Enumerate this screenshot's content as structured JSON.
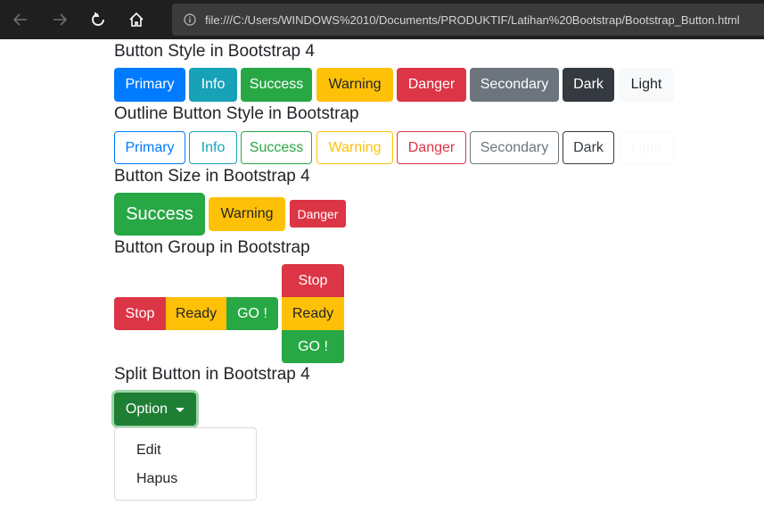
{
  "browser": {
    "url": "file:///C:/Users/WINDOWS%2010/Documents/PRODUKTIF/Latihan%20Bootstrap/Bootstrap_Button.html",
    "icons": [
      "back-arrow-icon",
      "forward-arrow-icon",
      "reload-icon",
      "home-icon",
      "info-icon"
    ]
  },
  "sections": {
    "styles_title": "Button Style in Bootstrap 4",
    "outline_title": "Outline Button Style in Bootstrap",
    "size_title": "Button Size in Bootstrap 4",
    "group_title": "Button Group in Bootstrap",
    "split_title": "Split Button in Bootstrap 4"
  },
  "style_buttons": [
    "Primary",
    "Info",
    "Success",
    "Warning",
    "Danger",
    "Secondary",
    "Dark",
    "Light"
  ],
  "outline_buttons": [
    "Primary",
    "Info",
    "Success",
    "Warning",
    "Danger",
    "Secondary",
    "Dark",
    "Light"
  ],
  "size_buttons": {
    "large": "Success",
    "default": "Warning",
    "small": "Danger"
  },
  "group_horizontal": [
    "Stop",
    "Ready",
    "GO !"
  ],
  "group_vertical": [
    "Stop",
    "Ready",
    "GO !"
  ],
  "split": {
    "label": "Option",
    "menu_items": [
      "Edit",
      "Hapus"
    ]
  },
  "colors": {
    "primary": "#007bff",
    "info": "#17a2b8",
    "success": "#28a745",
    "warning": "#ffc107",
    "danger": "#dc3545",
    "secondary": "#6c757d",
    "dark": "#343a40",
    "light": "#f8f9fa"
  }
}
